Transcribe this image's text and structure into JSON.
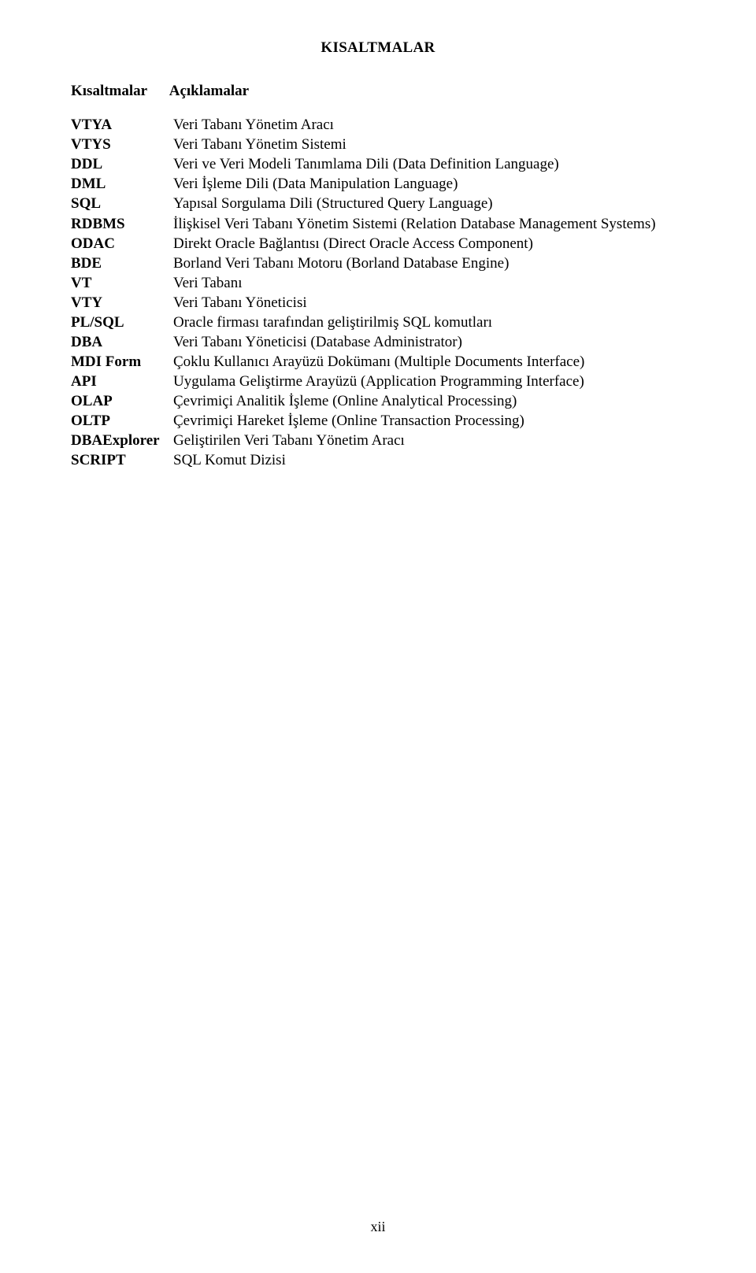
{
  "title": "KISALTMALAR",
  "header_col1": "Kısaltmalar",
  "header_col2": "Açıklamalar",
  "entries": [
    {
      "abbr": "VTYA",
      "desc": "Veri Tabanı Yönetim Aracı"
    },
    {
      "abbr": "VTYS",
      "desc": "Veri Tabanı Yönetim Sistemi"
    },
    {
      "abbr": "DDL",
      "desc": "Veri ve Veri Modeli Tanımlama Dili (Data Definition Language)"
    },
    {
      "abbr": "DML",
      "desc": "Veri İşleme Dili (Data Manipulation Language)"
    },
    {
      "abbr": "SQL",
      "desc": "Yapısal Sorgulama Dili (Structured Query Language)"
    },
    {
      "abbr": "RDBMS",
      "desc": "İlişkisel Veri Tabanı Yönetim Sistemi (Relation Database Management Systems)"
    },
    {
      "abbr": "ODAC",
      "desc": "Direkt Oracle Bağlantısı (Direct Oracle Access Component)"
    },
    {
      "abbr": "BDE",
      "desc": "Borland Veri Tabanı Motoru (Borland Database Engine)"
    },
    {
      "abbr": "VT",
      "desc": "Veri Tabanı"
    },
    {
      "abbr": "VTY",
      "desc": "Veri Tabanı Yöneticisi"
    },
    {
      "abbr": "PL/SQL",
      "desc": "Oracle firması tarafından geliştirilmiş SQL komutları"
    },
    {
      "abbr": "DBA",
      "desc": "Veri Tabanı Yöneticisi (Database Administrator)"
    },
    {
      "abbr": "MDI Form",
      "desc": "Çoklu Kullanıcı Arayüzü Dokümanı (Multiple Documents Interface)"
    },
    {
      "abbr": "API",
      "desc": "Uygulama Geliştirme Arayüzü (Application Programming Interface)"
    },
    {
      "abbr": "OLAP",
      "desc": "Çevrimiçi Analitik İşleme (Online Analytical Processing)"
    },
    {
      "abbr": "OLTP",
      "desc": "Çevrimiçi Hareket İşleme (Online Transaction Processing)"
    },
    {
      "abbr": "DBAExplorer",
      "desc": "Geliştirilen Veri Tabanı Yönetim Aracı"
    },
    {
      "abbr": "SCRIPT",
      "desc": "SQL Komut Dizisi"
    }
  ],
  "page_number": "xii"
}
